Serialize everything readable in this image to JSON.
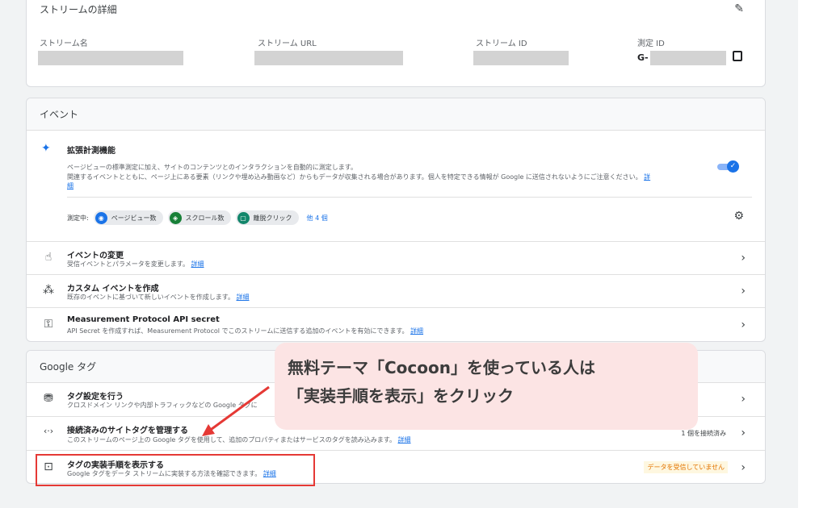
{
  "stream_details": {
    "title": "ストリームの詳細",
    "columns": [
      {
        "label": "ストリーム名",
        "value": ""
      },
      {
        "label": "ストリーム URL",
        "value": ""
      },
      {
        "label": "ストリーム ID",
        "value": ""
      },
      {
        "label": "測定 ID",
        "value": "G-"
      }
    ]
  },
  "events": {
    "title": "イベント",
    "enhanced": {
      "title": "拡張計測機能",
      "desc1": "ページビューの標準測定に加え、サイトのコンテンツとのインタラクションを自動的に測定します。",
      "desc2": "関連するイベントとともに、ページ上にある要素（リンクや埋め込み動画など）からもデータが収集される場合があります。個人を特定できる情報が Google に送信されないようにご注意ください。",
      "detail_link_a": "詳",
      "detail_link_b": "細",
      "measuring_label": "測定中:",
      "chips": [
        "ページビュー数",
        "スクロール数",
        "離脱クリック"
      ],
      "more": "他 4 個"
    },
    "rows": [
      {
        "title": "イベントの変更",
        "sub": "受信イベントとパラメータを変更します。",
        "link": "詳細"
      },
      {
        "title": "カスタム イベントを作成",
        "sub": "既存のイベントに基づいて新しいイベントを作成します。",
        "link": "詳細"
      },
      {
        "title": "Measurement Protocol API secret",
        "sub": "API Secret を作成すれば、Measurement Protocol でこのストリームに送信する追加のイベントを有効にできます。",
        "link": "詳細"
      }
    ]
  },
  "google_tag": {
    "title": "Google タグ",
    "rows": [
      {
        "title": "タグ設定を行う",
        "sub": "クロスドメイン リンクや内部トラフィックなどの Google タグに",
        "link": ""
      },
      {
        "title": "接続済みのサイトタグを管理する",
        "sub": "このストリームのページ上の Google タグを使用して、追加のプロパティまたはサービスのタグを読み込みます。",
        "link": "詳細",
        "badge": "1 個を接続済み"
      },
      {
        "title": "タグの実装手順を表示する",
        "sub": "Google タグをデータ ストリームに実装する方法を確認できます。",
        "link": "詳細",
        "badge": "データを受信していません"
      }
    ]
  },
  "callout": {
    "line1": "無料テーマ「Cocoon」を使っている人は",
    "line2": "「実装手順を表示」をクリック"
  },
  "colors": {
    "accent": "#1a73e8",
    "annotation": "#e53935",
    "callout_bg": "#fce4e4",
    "warning_badge": "#fef7e0"
  }
}
